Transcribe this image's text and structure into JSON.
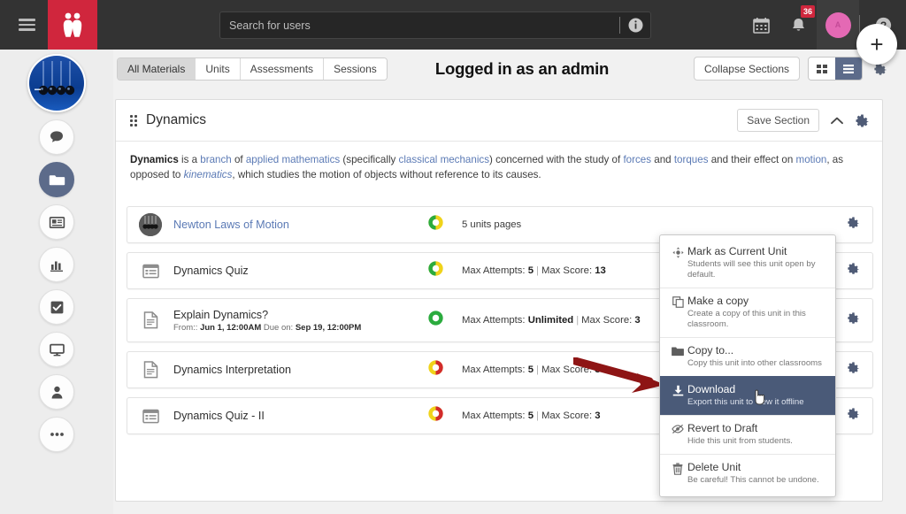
{
  "topbar": {
    "menu_icon": "hamburger-icon",
    "logo_icon": "people-logo-icon",
    "search": {
      "placeholder": "Search for users",
      "value": "",
      "info_icon": "info-icon"
    },
    "calendar_icon": "calendar-icon",
    "notifications_icon": "bell-icon",
    "notifications_count": "36",
    "avatar_initial": "A",
    "help_icon": "help-icon",
    "add_label": "+"
  },
  "rail": {
    "avatar_icon": "newtons-cradle-avatar",
    "items": [
      {
        "name": "messages",
        "icon": "chat-bubble-icon",
        "active": false
      },
      {
        "name": "materials",
        "icon": "folder-icon",
        "active": true
      },
      {
        "name": "news",
        "icon": "news-card-icon",
        "active": false
      },
      {
        "name": "reports",
        "icon": "bar-chart-icon",
        "active": false
      },
      {
        "name": "tasks",
        "icon": "checkbox-icon",
        "active": false
      },
      {
        "name": "presentation",
        "icon": "monitor-icon",
        "active": false
      },
      {
        "name": "profile",
        "icon": "person-icon",
        "active": false
      },
      {
        "name": "more",
        "icon": "ellipsis-icon",
        "active": false
      }
    ]
  },
  "content_header": {
    "tabs": [
      {
        "label": "All Materials",
        "selected": true
      },
      {
        "label": "Units",
        "selected": false
      },
      {
        "label": "Assessments",
        "selected": false
      },
      {
        "label": "Sessions",
        "selected": false
      }
    ],
    "admin_banner": "Logged in as an admin",
    "collapse_label": "Collapse Sections",
    "grid_view_icon": "grid-view-icon",
    "list_view_icon": "list-view-icon",
    "settings_icon": "gear-icon"
  },
  "section": {
    "drag_handle_icon": "drag-handle-icon",
    "title": "Dynamics",
    "save_label": "Save Section",
    "collapse_icon": "chevron-up-icon",
    "settings_icon": "gear-icon",
    "description": {
      "prefix_bold": "Dynamics",
      "t1": " is a ",
      "l1": "branch",
      "t2": " of ",
      "l2": "applied mathematics",
      "t3": " (specifically ",
      "l3": "classical mechanics",
      "t4": ") concerned with the study of ",
      "l4": "forces",
      "t5": " and ",
      "l5": "torques",
      "t6": " and their effect on ",
      "l6": "motion",
      "t7": ", as opposed to ",
      "l7": "kinematics",
      "t8": ", which studies the motion of objects without reference to its causes."
    }
  },
  "rows": [
    {
      "icon": "unit-thumbnail",
      "title": "Newton Laws of Motion",
      "sub": "",
      "status_colors": [
        "#2bab3e",
        "#f0d31a"
      ],
      "meta_plain": "5 units pages",
      "gear_icon": "gear-icon"
    },
    {
      "icon": "quiz-icon",
      "title": "Dynamics Quiz",
      "sub": "",
      "status_colors": [
        "#2bab3e",
        "#f0d31a"
      ],
      "meta_attempts_label": "Max Attempts: ",
      "meta_attempts_value": "5",
      "meta_score_label": "Max Score: ",
      "meta_score_value": "13",
      "gear_icon": "gear-icon"
    },
    {
      "icon": "document-icon",
      "title": "Explain Dynamics?",
      "sub_from_label": "From:: ",
      "sub_from_value": "Jun 1, 12:00AM",
      "sub_due_label": "  Due on: ",
      "sub_due_value": "Sep 19, 12:00PM",
      "status_colors": [
        "#2bab3e",
        "#2bab3e"
      ],
      "meta_attempts_label": "Max Attempts: ",
      "meta_attempts_value": "Unlimited",
      "meta_score_label": "Max Score: ",
      "meta_score_value": "3",
      "gear_icon": "gear-icon"
    },
    {
      "icon": "document-icon",
      "title": "Dynamics Interpretation",
      "sub": "",
      "status_colors": [
        "#f0d31a",
        "#d22b2b"
      ],
      "meta_attempts_label": "Max Attempts: ",
      "meta_attempts_value": "5",
      "meta_score_label": "Max Score: ",
      "meta_score_value": "3",
      "gear_icon": "gear-icon"
    },
    {
      "icon": "quiz-icon",
      "title": "Dynamics Quiz - II",
      "sub": "",
      "status_colors": [
        "#f0d31a",
        "#d22b2b"
      ],
      "meta_attempts_label": "Max Attempts: ",
      "meta_attempts_value": "5",
      "meta_score_label": "Max Score: ",
      "meta_score_value": "3",
      "gear_icon": "gear-icon"
    }
  ],
  "menu": {
    "items": [
      {
        "icon": "move-arrows-icon",
        "title": "Mark as Current Unit",
        "desc": "Students will see this unit open by default.",
        "highlighted": false
      },
      {
        "icon": "copy-icon",
        "title": "Make a copy",
        "desc": "Create a copy of this unit in this classroom.",
        "highlighted": false
      },
      {
        "icon": "folder-icon",
        "title": "Copy to...",
        "desc": "Copy this unit into other classrooms",
        "highlighted": false
      },
      {
        "icon": "download-icon",
        "title": "Download",
        "desc": "Export this unit to view it offline",
        "highlighted": true
      },
      {
        "icon": "eye-slash-icon",
        "title": "Revert to Draft",
        "desc": "Hide this unit from students.",
        "highlighted": false
      },
      {
        "icon": "trash-icon",
        "title": "Delete Unit",
        "desc": "Be careful! This cannot be undone.",
        "highlighted": false
      }
    ]
  },
  "annotation": {
    "arrow_color": "#8e1515",
    "arrow_target": "Download"
  },
  "colors": {
    "brand_red": "#d0263d",
    "topbar": "#333333",
    "accent_blue": "#5c6b8a",
    "link_blue": "#5b7ab5",
    "status_green": "#2bab3e",
    "status_yellow": "#f0d31a",
    "status_red": "#d22b2b"
  }
}
